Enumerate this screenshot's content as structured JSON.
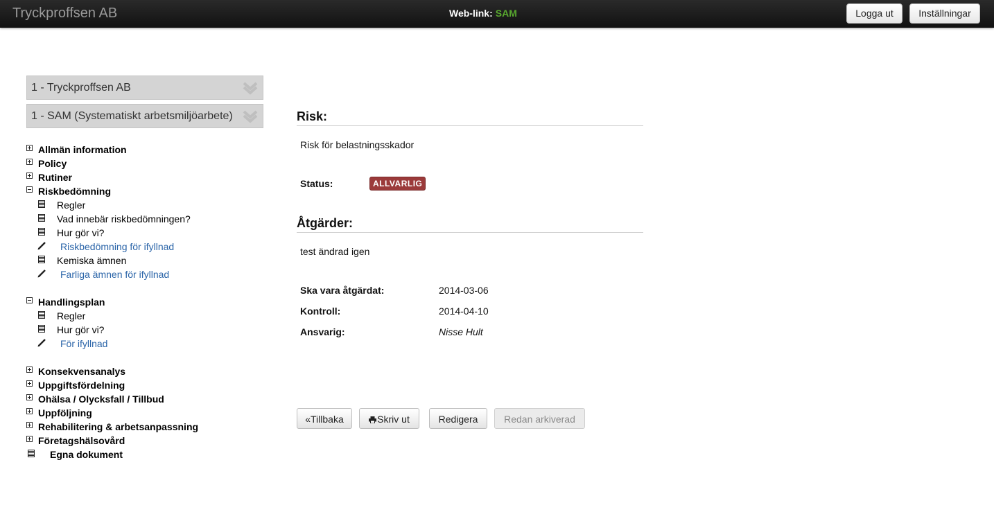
{
  "topbar": {
    "brand": "Tryckproffsen AB",
    "weblink_label": "Web-link:",
    "weblink_value": "SAM",
    "logout": "Logga ut",
    "settings": "Inställningar"
  },
  "selects": {
    "company": "1 - Tryckproffsen AB",
    "system": "1 - SAM (Systematiskt arbetsmiljöarbete)"
  },
  "nav": {
    "allman": "Allmän information",
    "policy": "Policy",
    "rutiner": "Rutiner",
    "riskbedomning": {
      "label": "Riskbedömning",
      "items": [
        "Regler",
        "Vad innebär riskbedömningen?",
        "Hur gör vi?",
        "Riskbedömning för ifyllnad",
        "Kemiska ämnen",
        "Farliga ämnen för ifyllnad"
      ]
    },
    "handlingsplan": {
      "label": "Handlingsplan",
      "items": [
        "Regler",
        "Hur gör vi?",
        "För ifyllnad"
      ]
    },
    "konsekvensanalys": "Konsekvensanalys",
    "uppgiftsfordelning": "Uppgiftsfördelning",
    "ohalsa": "Ohälsa / Olycksfall / Tillbud",
    "uppfoljning": "Uppföljning",
    "rehabilitering": "Rehabilitering & arbetsanpassning",
    "foretagshalsovard": "Företagshälsovård",
    "egna": "Egna dokument"
  },
  "risk": {
    "heading": "Risk:",
    "text": "Risk för belastningsskador",
    "status_label": "Status:",
    "status_value": "ALLVARLIG",
    "status_color": "#9b3a3a"
  },
  "atgarder": {
    "heading": "Åtgärder:",
    "text": "test ändrad igen",
    "fields": [
      {
        "label": "Ska vara åtgärdat:",
        "value": "2014-03-06"
      },
      {
        "label": "Kontroll:",
        "value": "2014-04-10"
      },
      {
        "label": "Ansvarig:",
        "value": "Nisse Hult"
      }
    ]
  },
  "actions": {
    "back": "«Tillbaka",
    "print": "Skriv ut",
    "edit": "Redigera",
    "archived": "Redan arkiverad"
  }
}
